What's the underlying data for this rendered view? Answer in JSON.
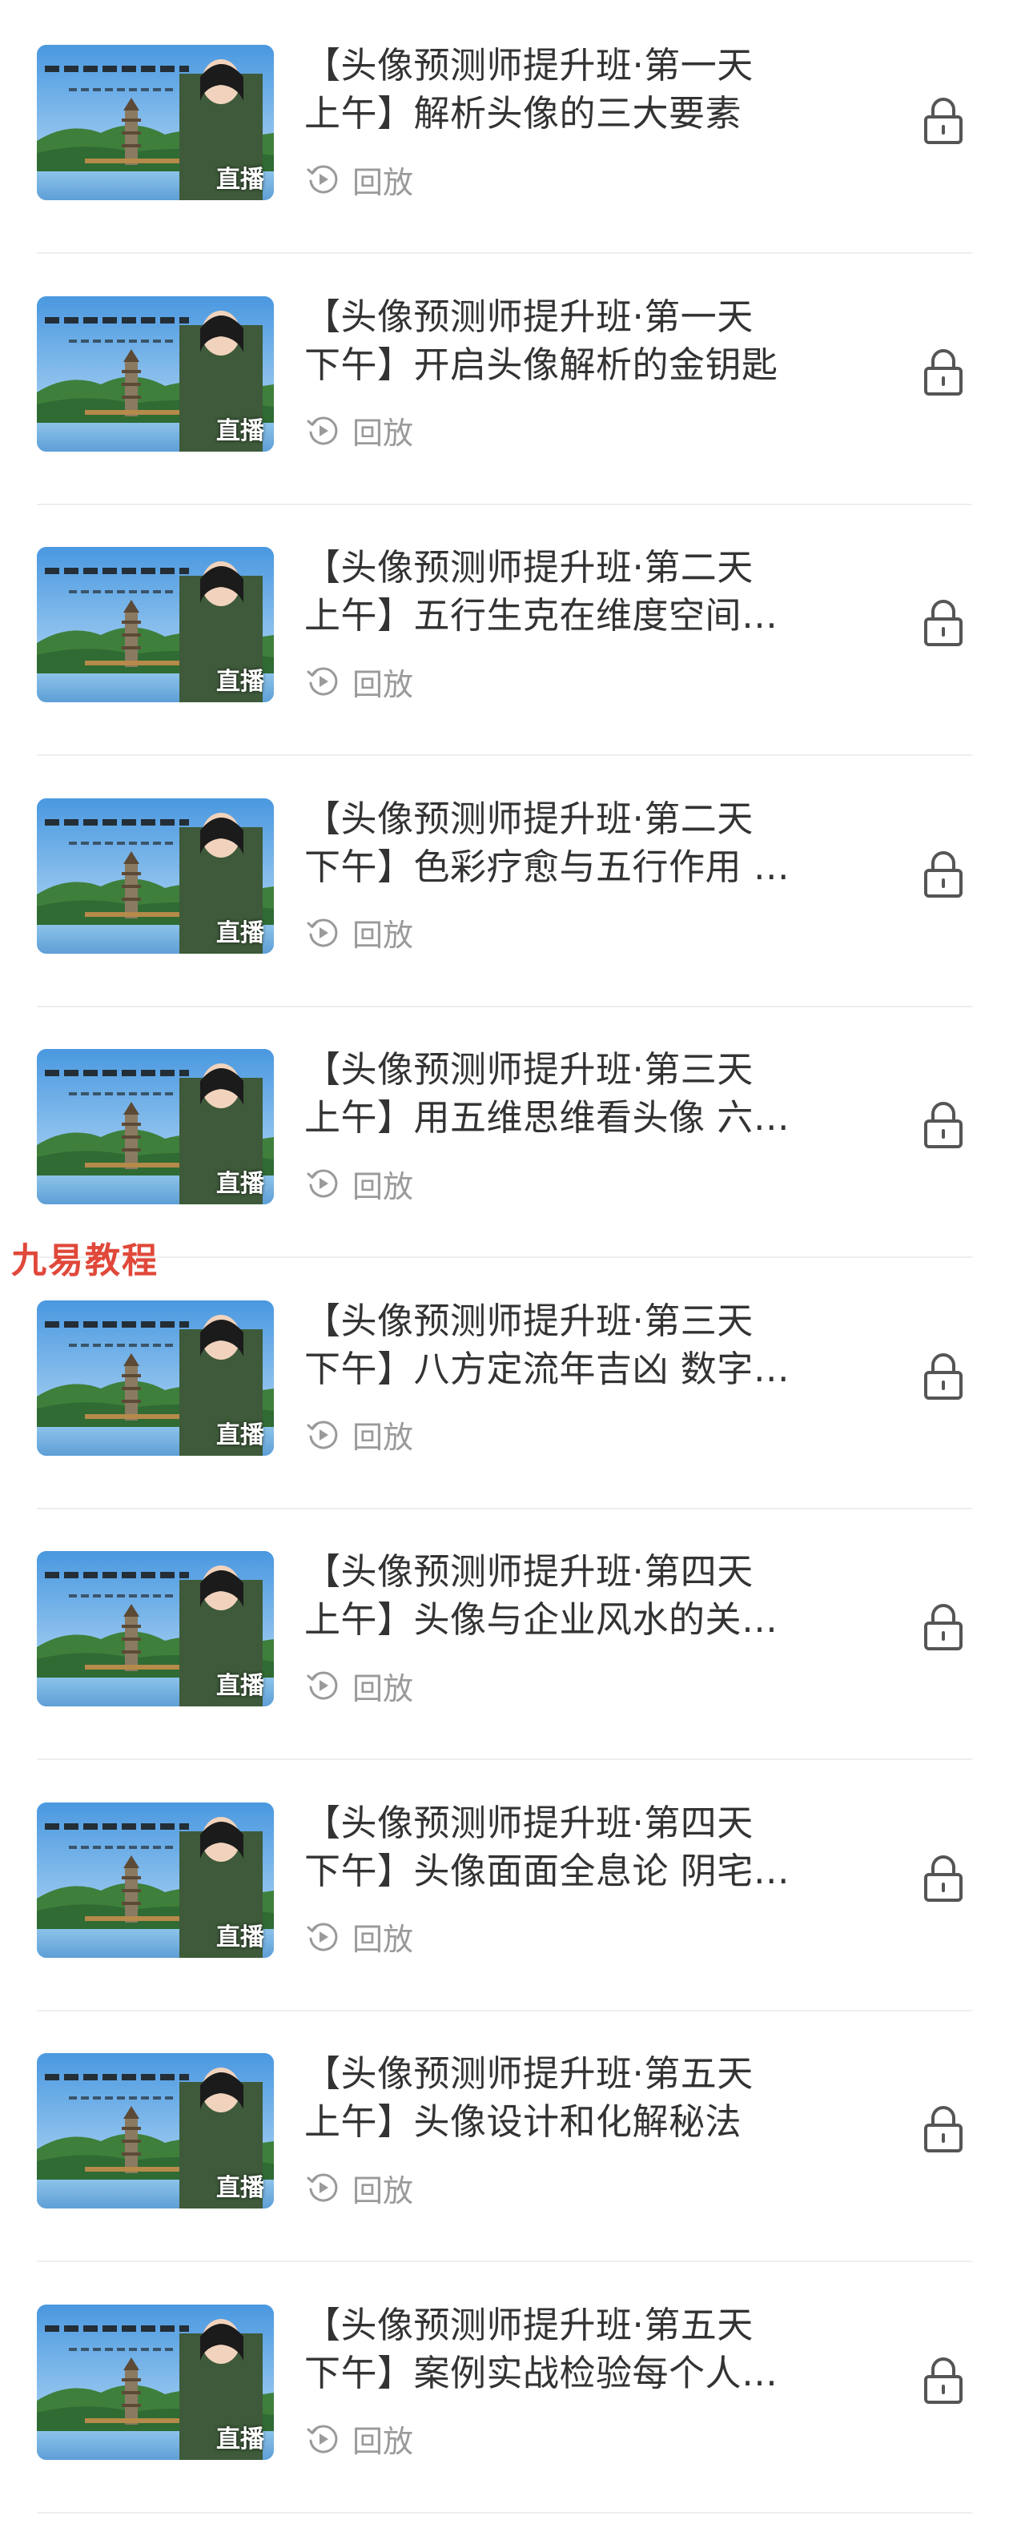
{
  "lessons": [
    {
      "title": "【头像预测师提升班·第一天\n上午】解析头像的三大要素",
      "badge": "直播",
      "replay_label": "回放"
    },
    {
      "title": "【头像预测师提升班·第一天\n下午】开启头像解析的金钥匙",
      "badge": "直播",
      "replay_label": "回放"
    },
    {
      "title": "【头像预测师提升班·第二天\n上午】五行生克在维度空间…",
      "badge": "直播",
      "replay_label": "回放"
    },
    {
      "title": "【头像预测师提升班·第二天\n下午】色彩疗愈与五行作用 …",
      "badge": "直播",
      "replay_label": "回放"
    },
    {
      "title": "【头像预测师提升班·第三天\n上午】用五维思维看头像 六…",
      "badge": "直播",
      "replay_label": "回放"
    },
    {
      "title": "【头像预测师提升班·第三天\n下午】八方定流年吉凶 数字…",
      "badge": "直播",
      "replay_label": "回放"
    },
    {
      "title": "【头像预测师提升班·第四天\n上午】头像与企业风水的关…",
      "badge": "直播",
      "replay_label": "回放"
    },
    {
      "title": "【头像预测师提升班·第四天\n下午】头像面面全息论 阴宅…",
      "badge": "直播",
      "replay_label": "回放"
    },
    {
      "title": "【头像预测师提升班·第五天\n上午】头像设计和化解秘法",
      "badge": "直播",
      "replay_label": "回放"
    },
    {
      "title": "【头像预测师提升班·第五天\n下午】案例实战检验每个人…",
      "badge": "直播",
      "replay_label": "回放"
    }
  ],
  "watermark": "九易教程",
  "icons": {
    "replay": "replay-icon",
    "lock": "lock-icon"
  },
  "colors": {
    "title": "#333333",
    "meta": "#9a9a9a",
    "divider": "#eeeeee",
    "watermark": "#e0483a"
  }
}
